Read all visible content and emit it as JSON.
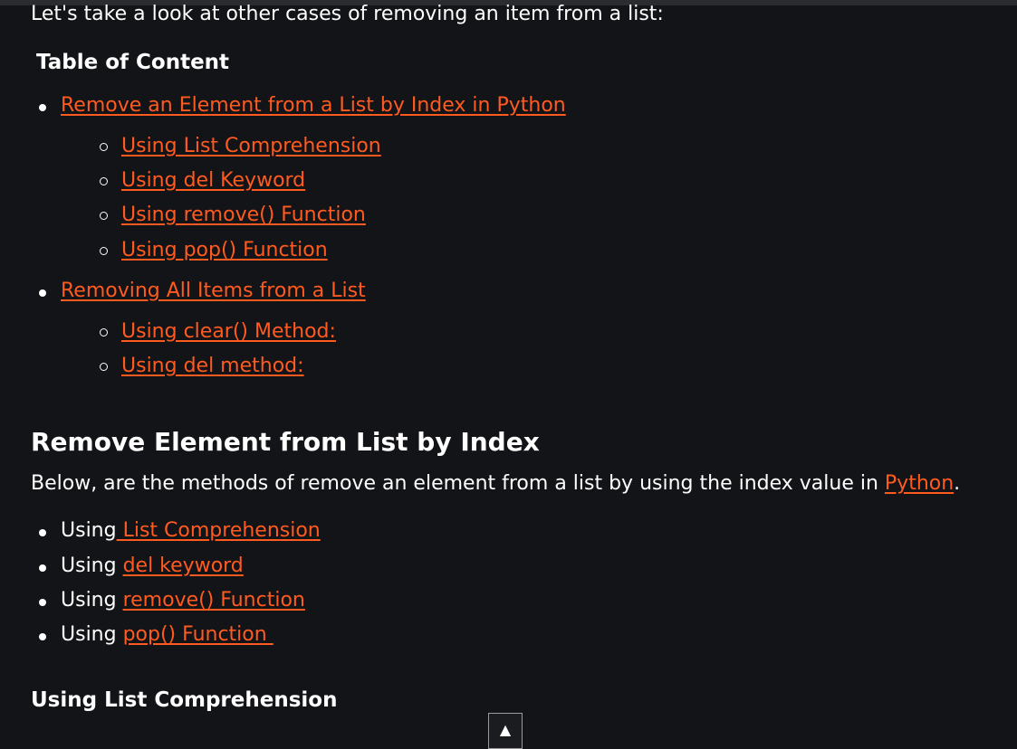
{
  "intro": "Let's take a look at other cases of removing an item from a list:",
  "toc": {
    "title": "Table of Content",
    "items": [
      {
        "label": "Remove an Element from a List by Index in Python",
        "children": [
          "Using List Comprehension",
          "Using del Keyword",
          "Using remove() Function",
          "Using pop() Function"
        ]
      },
      {
        "label": "Removing All Items from a List",
        "children": [
          "Using clear() Method:",
          "Using del method:"
        ]
      }
    ]
  },
  "section": {
    "heading": "Remove Element from List by Index",
    "paragraph_before": "Below, are the methods of remove an element from a list by using the index value in ",
    "paragraph_link": "Python",
    "paragraph_after": ".",
    "methods": [
      {
        "prefix": "Using",
        "link": " List Comprehension"
      },
      {
        "prefix": "Using ",
        "link": "del keyword"
      },
      {
        "prefix": "Using ",
        "link": "remove() Function"
      },
      {
        "prefix": "Using ",
        "link": "pop() Function "
      }
    ]
  },
  "subheading": "Using List Comprehension",
  "scroll_top_icon": "▲"
}
